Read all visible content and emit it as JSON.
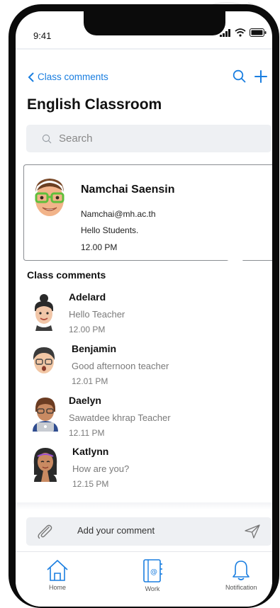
{
  "status_bar": {
    "time": "9:41"
  },
  "nav": {
    "back_label": "Class comments"
  },
  "page": {
    "title": "English Classroom"
  },
  "search": {
    "placeholder": "Search"
  },
  "post": {
    "author": "Namchai Saensin",
    "email": "Namchai@mh.ac.th",
    "message": "Hello Students.",
    "time": "12.00 PM"
  },
  "comments_section": {
    "title": "Class comments"
  },
  "comments": [
    {
      "name": "Adelard",
      "text": "Hello Teacher",
      "time": "12.00 PM"
    },
    {
      "name": "Benjamin",
      "text": "Good afternoon teacher",
      "time": "12.01 PM"
    },
    {
      "name": "Daelyn",
      "text": "Sawatdee khrap Teacher",
      "time": "12.11 PM"
    },
    {
      "name": "Katlynn",
      "text": "How are you?",
      "time": "12.15 PM"
    }
  ],
  "composer": {
    "placeholder": "Add your comment"
  },
  "tabbar": {
    "items": [
      {
        "label": "Home",
        "icon": "home-icon"
      },
      {
        "label": "Work",
        "icon": "notebook-icon"
      },
      {
        "label": "Notification",
        "icon": "bell-icon"
      }
    ]
  },
  "colors": {
    "accent": "#1a7ee0",
    "muted_text": "#7a7a7a",
    "field_bg": "#eef0f3"
  }
}
